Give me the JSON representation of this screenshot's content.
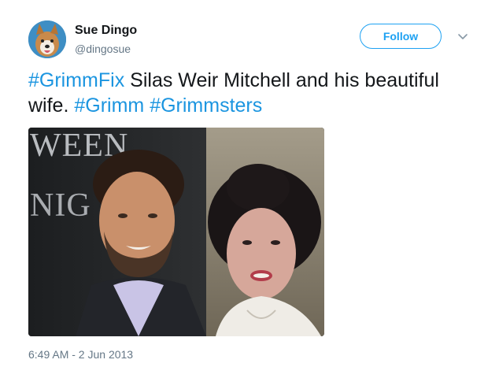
{
  "user": {
    "name": "Sue Dingo",
    "handle": "@dingosue"
  },
  "actions": {
    "follow_label": "Follow",
    "menu_icon": "chevron-down-icon"
  },
  "tweet": {
    "hashtag_1": "#GrimmFix",
    "text_1": " Silas Weir Mitchell and his beautiful wife. ",
    "hashtag_2": "#Grimm",
    "text_2": " ",
    "hashtag_3": "#Grimmsters"
  },
  "media": {
    "poster_text": "WEEN NIG"
  },
  "meta": {
    "timestamp": "6:49 AM - 2 Jun 2013"
  },
  "colors": {
    "accent": "#1da1f2",
    "hashtag": "#1b95e0",
    "secondary_text": "#657786"
  }
}
